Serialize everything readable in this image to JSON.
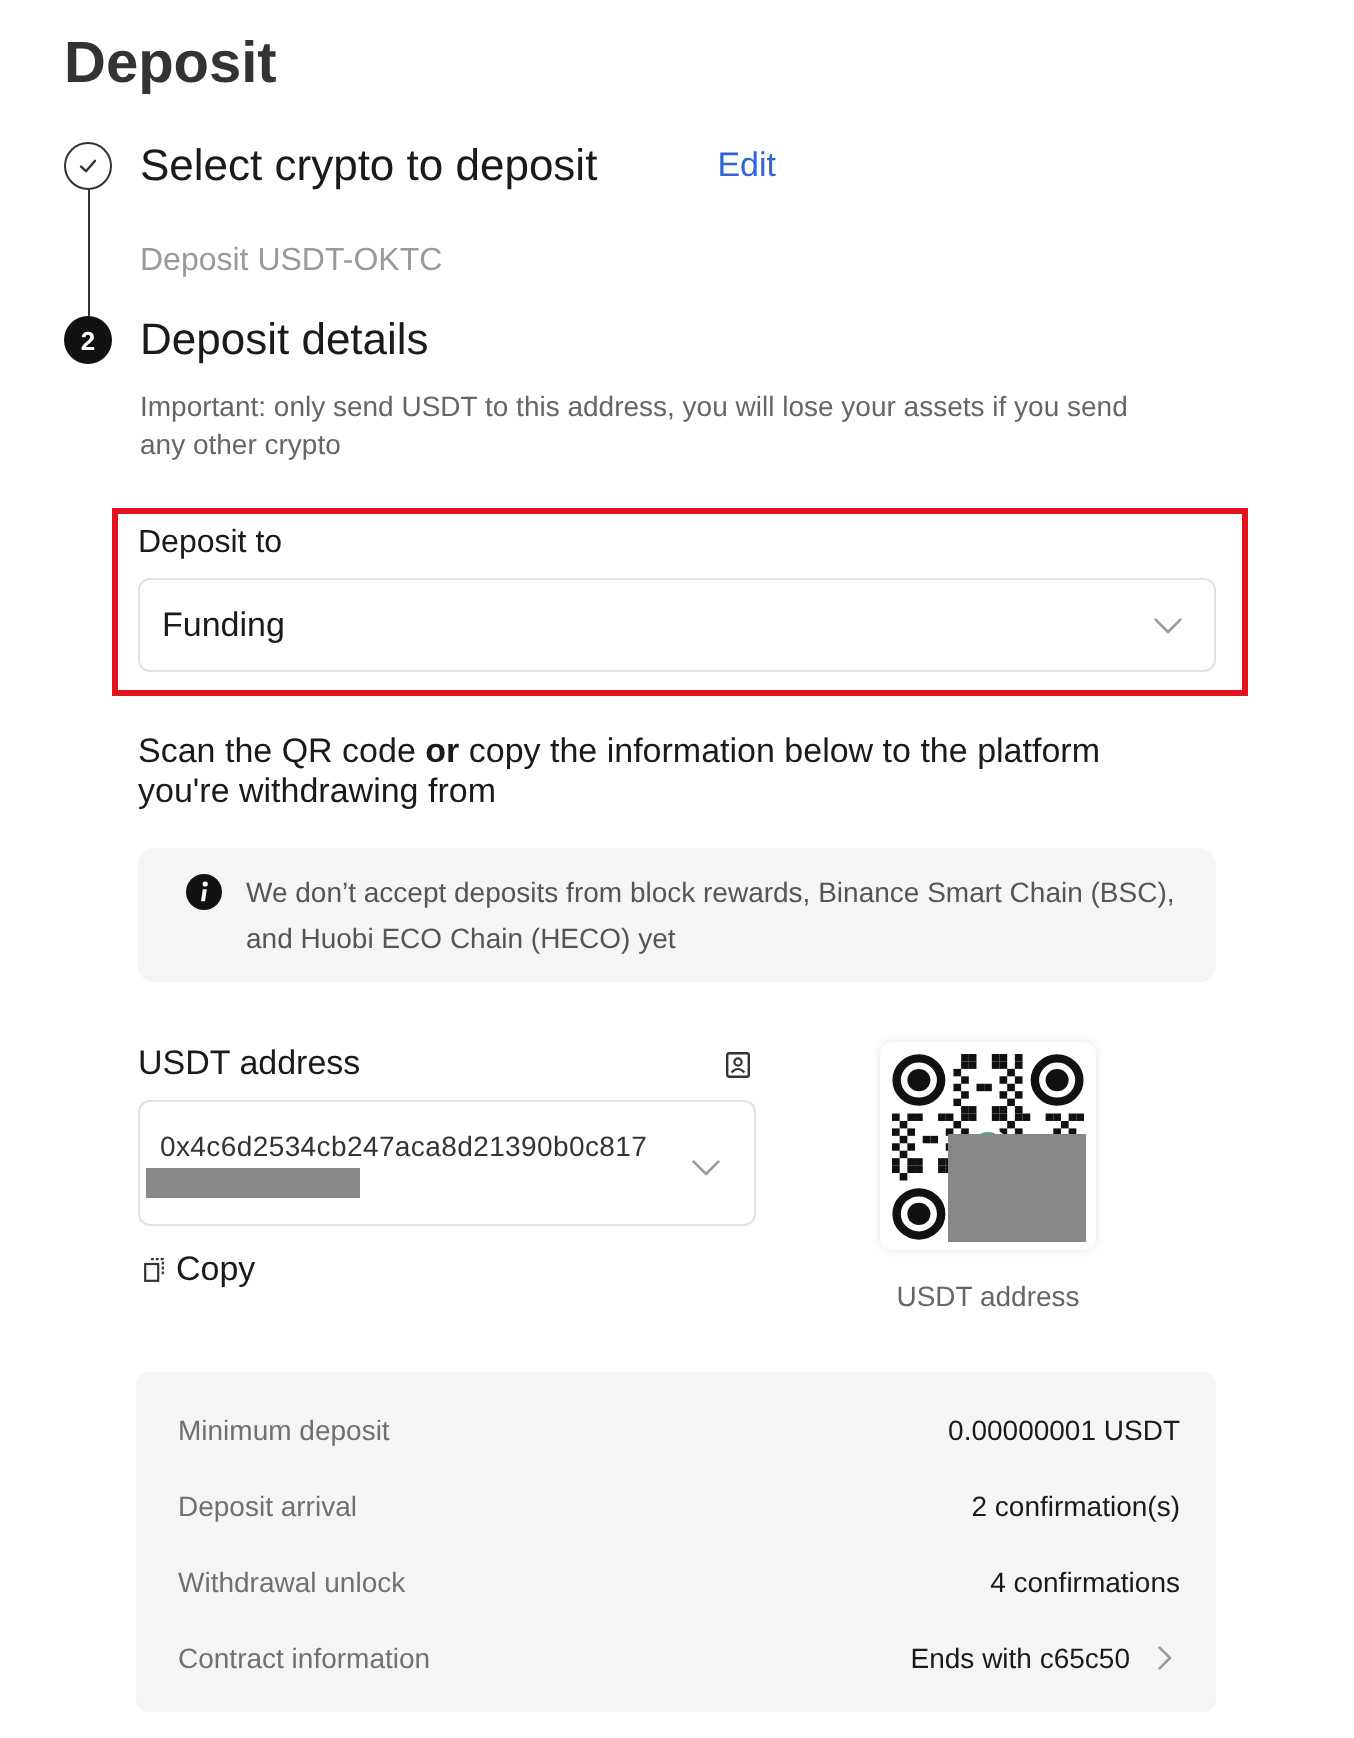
{
  "page": {
    "title": "Deposit"
  },
  "steps": [
    {
      "completed": true,
      "title": "Select crypto to deposit",
      "action": "Edit",
      "summary": "Deposit USDT-OKTC"
    },
    {
      "completed": false,
      "number": "2",
      "title": "Deposit details",
      "note": "Important: only send USDT to this address, you will lose your assets if you send any other crypto"
    }
  ],
  "deposit_to": {
    "label": "Deposit to",
    "value": "Funding",
    "highlighted": true
  },
  "instructions": "Scan the QR code **or** copy the information below to the platform you're withdrawing from",
  "notice": "We don’t accept deposits from block rewards, Binance Smart Chain (BSC), and Huobi ECO Chain (HECO) yet",
  "address": {
    "label": "USDT address",
    "value": "0x4c6d2534cb247aca8d21390b0c817",
    "redacted": true,
    "copy": "Copy"
  },
  "qr": {
    "caption": "USDT address",
    "redacted": true
  },
  "details": [
    {
      "label": "Minimum deposit",
      "value": "0.00000001 USDT",
      "kind": "text"
    },
    {
      "label": "Deposit arrival",
      "value": "2 confirmation(s)",
      "kind": "text"
    },
    {
      "label": "Withdrawal unlock",
      "value": "4 confirmations",
      "kind": "text"
    },
    {
      "label": "Contract information",
      "value": "Ends with c65c50",
      "kind": "link"
    }
  ]
}
